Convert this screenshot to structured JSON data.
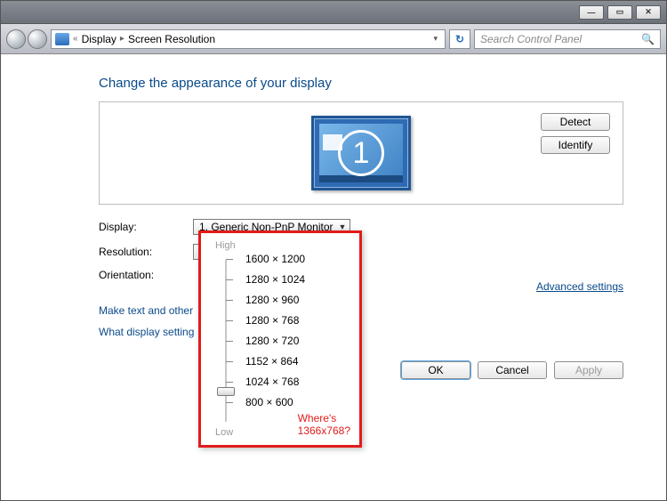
{
  "titlebar": {
    "minimize": "—",
    "maximize": "▭",
    "close": "✕"
  },
  "breadcrumb": {
    "root_icon": "control-panel-icon",
    "sep1": "«",
    "item1": "Display",
    "sep2": "▸",
    "item2": "Screen Resolution"
  },
  "refresh_icon": "↻",
  "search": {
    "placeholder": "Search Control Panel",
    "icon": "🔍"
  },
  "heading": "Change the appearance of your display",
  "monitor_number": "1",
  "panel": {
    "detect": "Detect",
    "identify": "Identify"
  },
  "labels": {
    "display": "Display:",
    "resolution": "Resolution:",
    "orientation": "Orientation:"
  },
  "dropdowns": {
    "display_value": "1. Generic Non-PnP Monitor",
    "resolution_value": "1024 × 768"
  },
  "advanced_link": "Advanced settings",
  "links": {
    "link1": "Make text and other",
    "link2": "What display setting"
  },
  "footer": {
    "ok": "OK",
    "cancel": "Cancel",
    "apply": "Apply"
  },
  "res_popup": {
    "high": "High",
    "low": "Low",
    "options": [
      "1600 × 1200",
      "1280 × 1024",
      "1280 × 960",
      "1280 × 768",
      "1280 × 720",
      "1152 × 864",
      "1024 × 768",
      "800 × 600"
    ],
    "selected_index": 6,
    "annotation_line1": "Where's",
    "annotation_line2": "1366x768?"
  }
}
